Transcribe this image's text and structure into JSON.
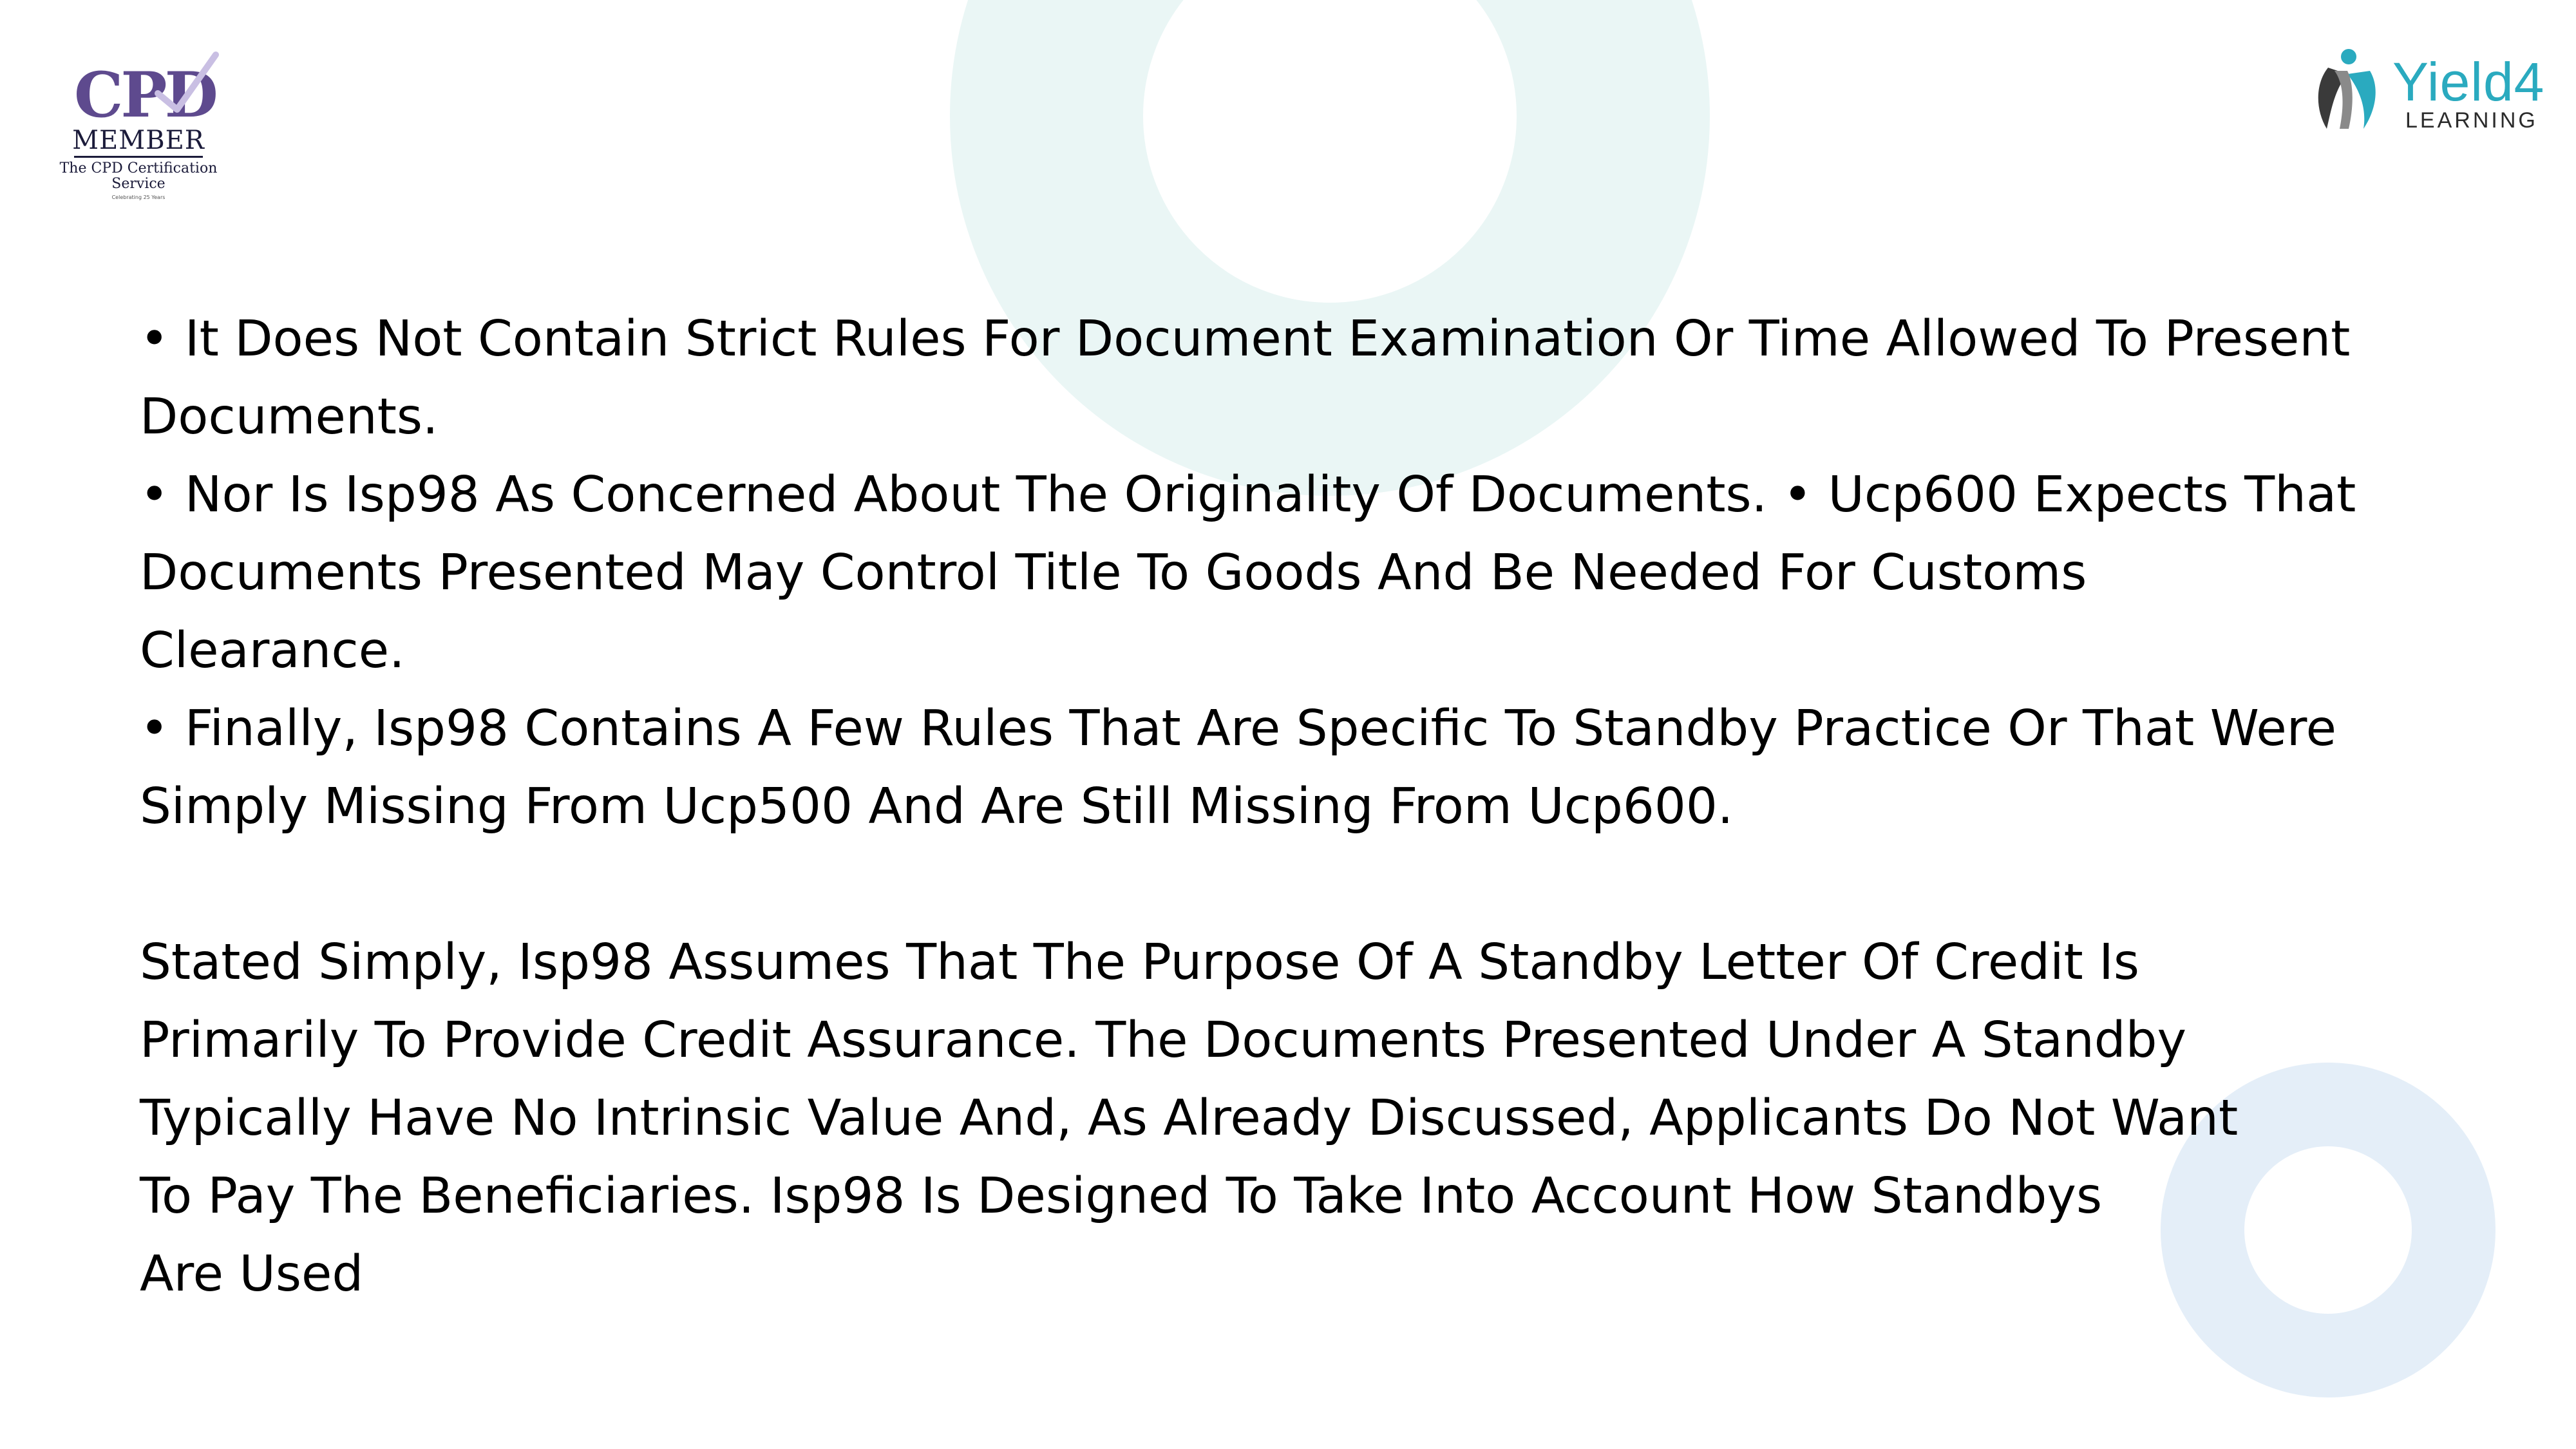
{
  "logos": {
    "cpd": {
      "mark": "CPD",
      "member": "MEMBER",
      "service": "The CPD Certification Service",
      "small_print": "Celebrating 25 Years",
      "color": "#5e4a8e"
    },
    "yield4": {
      "name": "Yield4",
      "tagline": "LEARNING",
      "color": "#2aaabf"
    }
  },
  "body": {
    "bullet_1": "• It Does Not Contain Strict Rules For Document Examination Or Time Allowed To Present\nDocuments.",
    "bullet_2": "• Nor Is Isp98 As Concerned About The Originality Of Documents. • Ucp600 Expects That\nDocuments Presented May Control Title To Goods And Be Needed For Customs\nClearance.",
    "bullet_3": "• Finally, Isp98 Contains A Few Rules That Are Specific To Standby Practice Or That Were\nSimply Missing From Ucp500 And Are Still Missing From Ucp600.",
    "paragraph": "Stated Simply, Isp98 Assumes That The Purpose Of A Standby Letter Of Credit Is\nPrimarily To Provide Credit Assurance. The Documents Presented Under A Standby\nTypically Have No Intrinsic Value And, As Already Discussed, Applicants Do Not Want\nTo Pay The Beneficiaries. Isp98 Is Designed To Take Into Account How Standbys\nAre Used"
  },
  "colors": {
    "ring_top": "#eaf6f5",
    "ring_bottom": "#e4eef8"
  }
}
